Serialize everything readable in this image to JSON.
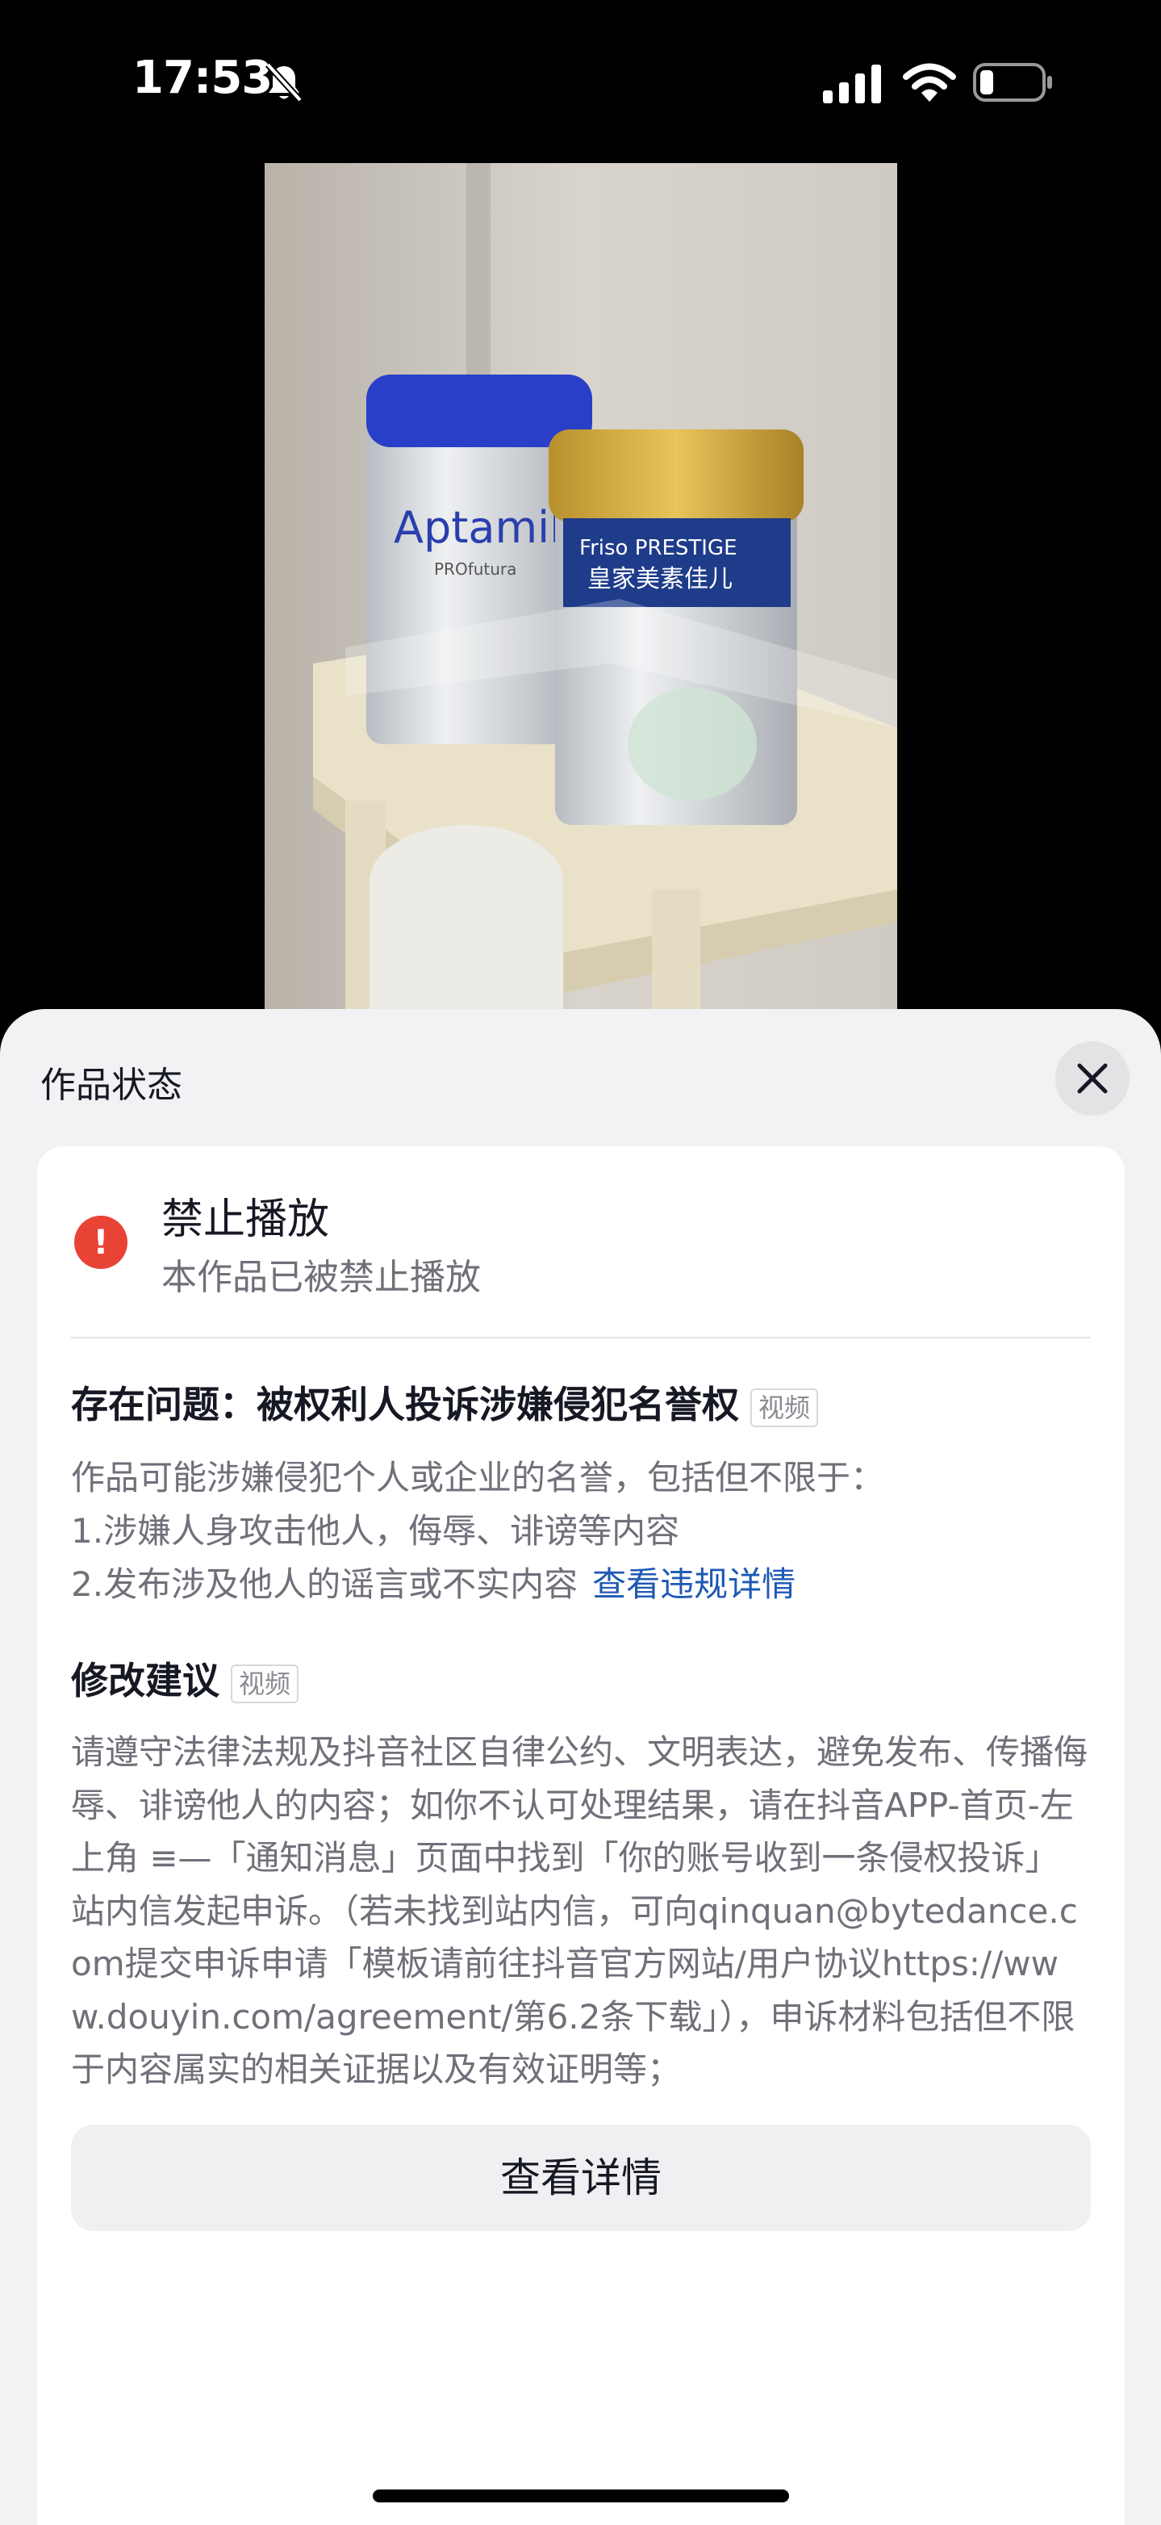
{
  "status_bar": {
    "time": "17:53"
  },
  "sheet": {
    "title": "作品状态",
    "status": {
      "title": "禁止播放",
      "description": "本作品已被禁止播放"
    },
    "issue": {
      "heading": "存在问题：被权利人投诉涉嫌侵犯名誉权",
      "tag": "视频",
      "lines": [
        "作品可能涉嫌侵犯个人或企业的名誉，包括但不限于：",
        "1.涉嫌人身攻击他人，侮辱、诽谤等内容",
        "2.发布涉及他人的谣言或不实内容"
      ],
      "link": "查看违规详情"
    },
    "suggestion": {
      "heading": "修改建议",
      "tag": "视频",
      "body": "请遵守法律法规及抖音社区自律公约、文明表达，避免发布、传播侮辱、诽谤他人的内容；如你不认可处理结果，请在抖音APP-首页-左上角 ≡—「通知消息」页面中找到「你的账号收到一条侵权投诉」站内信发起申诉。（若未找到站内信，可向qinquan@bytedance.com提交申诉申请「模板请前往抖音官方网站/用户协议https://www.douyin.com/agreement/第6.2条下载」），申诉材料包括但不限于内容属实的相关证据以及有效证明等；"
    },
    "details_button": "查看详情"
  },
  "video": {
    "can1_brand": "Aptamil",
    "can1_sub": "PROfutura",
    "can2_brand": "Friso PRESTIGE",
    "can2_cn": "皇家美素佳儿"
  }
}
